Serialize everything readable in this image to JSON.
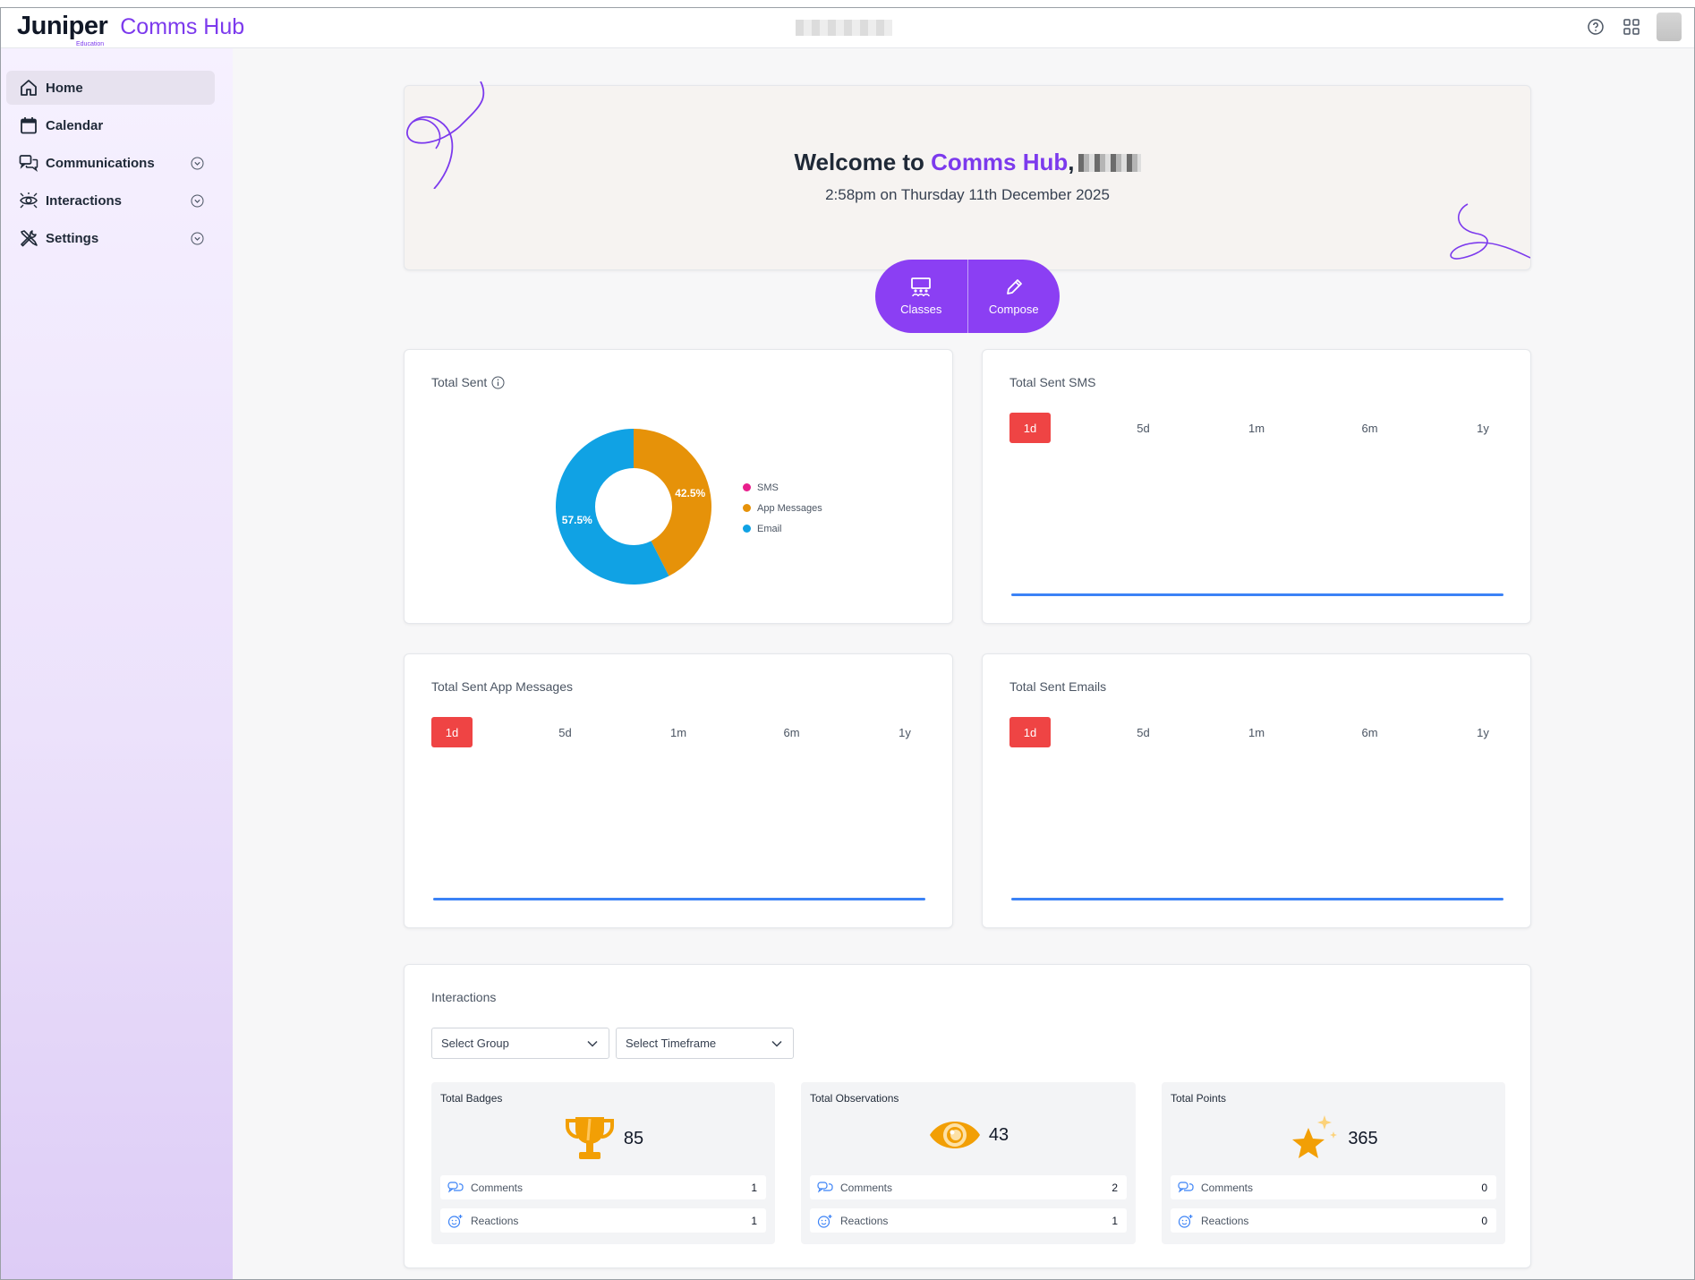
{
  "topbar": {
    "logo": "Juniper",
    "logo_sub": "Education",
    "app_name": "Comms Hub"
  },
  "sidebar": {
    "items": [
      {
        "label": "Home"
      },
      {
        "label": "Calendar"
      },
      {
        "label": "Communications"
      },
      {
        "label": "Interactions"
      },
      {
        "label": "Settings"
      }
    ]
  },
  "hero": {
    "welcome": "Welcome to ",
    "brand": "Comms Hub",
    "comma": ",",
    "datetime": "2:58pm on Thursday 11th December 2025",
    "classes_label": "Classes",
    "compose_label": "Compose"
  },
  "total_sent": {
    "title": "Total Sent",
    "legend": [
      "SMS",
      "App Messages",
      "Email"
    ],
    "colors": {
      "sms": "#e91e8c",
      "app": "#e69209",
      "email": "#10a2e4"
    }
  },
  "chart_data": {
    "type": "pie",
    "categories": [
      "SMS",
      "App Messages",
      "Email"
    ],
    "values": [
      0,
      42.5,
      57.5
    ],
    "labels": [
      "",
      "42.5%",
      "57.5%"
    ]
  },
  "panels": {
    "sms": {
      "title": "Total Sent SMS"
    },
    "app": {
      "title": "Total Sent App Messages"
    },
    "email": {
      "title": "Total Sent Emails"
    },
    "ranges": [
      "1d",
      "5d",
      "1m",
      "6m",
      "1y"
    ],
    "selected_range": "1d"
  },
  "interactions": {
    "title": "Interactions",
    "select_group": "Select Group",
    "select_timeframe": "Select Timeframe",
    "comments_label": "Comments",
    "reactions_label": "Reactions",
    "stats": [
      {
        "title": "Total Badges",
        "value": "85",
        "comments": "1",
        "reactions": "1"
      },
      {
        "title": "Total Observations",
        "value": "43",
        "comments": "2",
        "reactions": "1"
      },
      {
        "title": "Total Points",
        "value": "365",
        "comments": "0",
        "reactions": "0"
      }
    ]
  }
}
